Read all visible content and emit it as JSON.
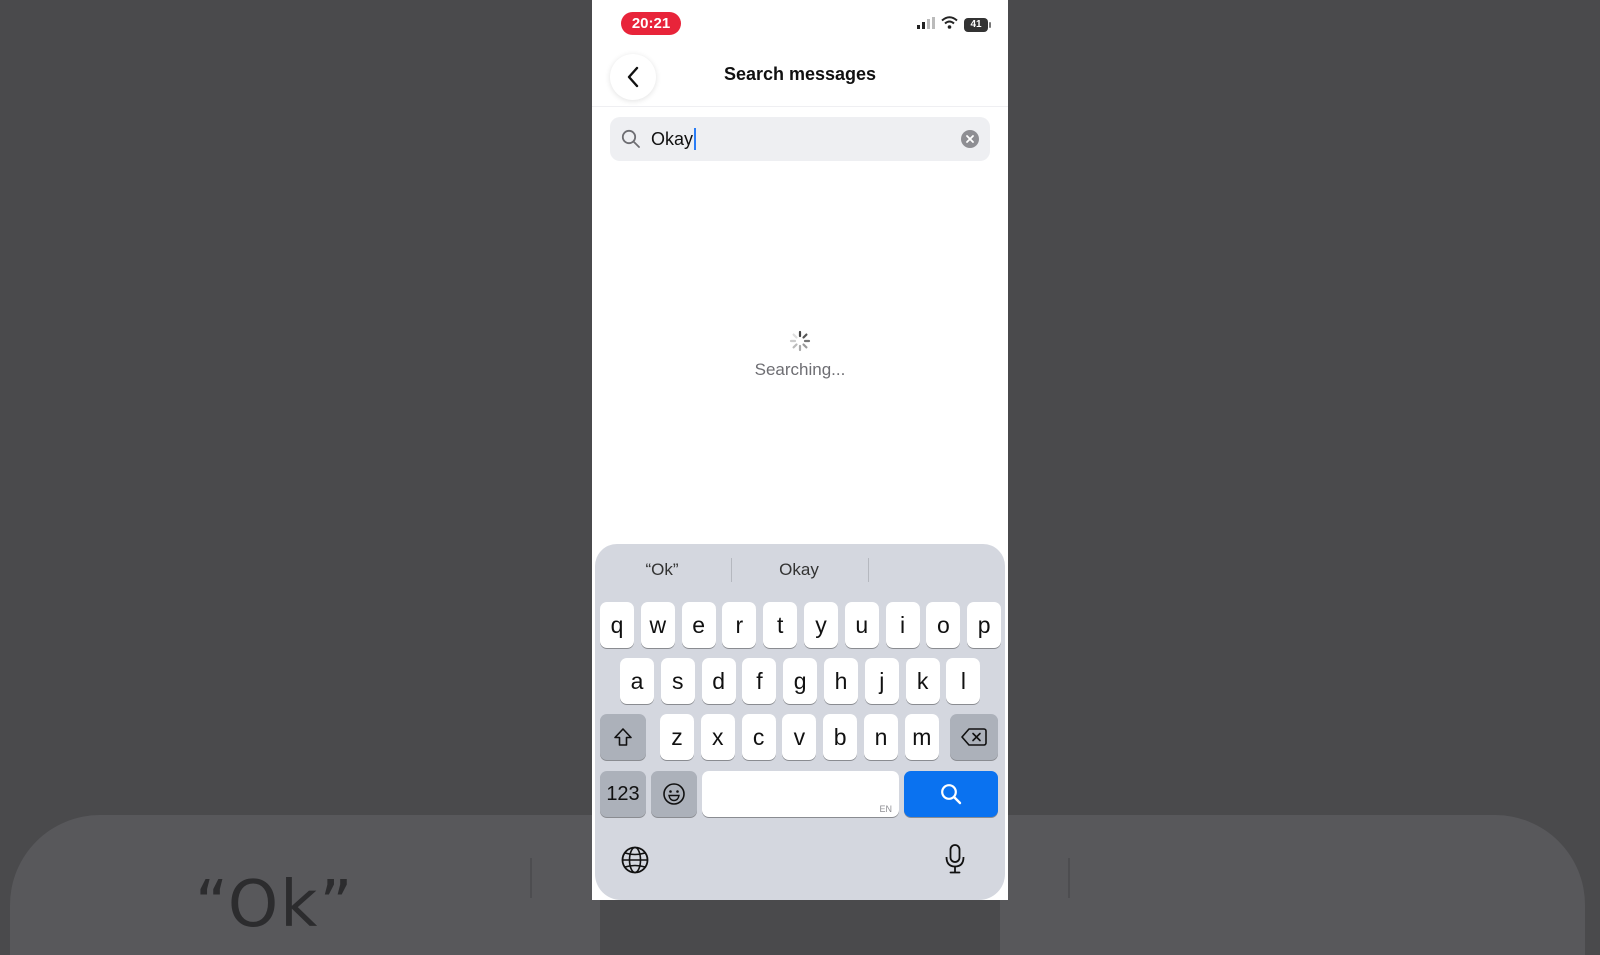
{
  "status_bar": {
    "time": "20:21",
    "battery": "41"
  },
  "header": {
    "title": "Search messages"
  },
  "search": {
    "value": "Okay"
  },
  "loading": {
    "text": "Searching..."
  },
  "keyboard": {
    "suggestions": [
      "“Ok”",
      "Okay"
    ],
    "row1": [
      "q",
      "w",
      "e",
      "r",
      "t",
      "y",
      "u",
      "i",
      "o",
      "p"
    ],
    "row2": [
      "a",
      "s",
      "d",
      "f",
      "g",
      "h",
      "j",
      "k",
      "l"
    ],
    "row3": [
      "z",
      "x",
      "c",
      "v",
      "b",
      "n",
      "m"
    ],
    "numbers_label": "123",
    "space_language": "EN"
  },
  "background": {
    "ghost_text": "“Ok”"
  },
  "colors": {
    "time_pill": "#e8243a",
    "search_key": "#0a72f0",
    "caret": "#2a7df6"
  }
}
